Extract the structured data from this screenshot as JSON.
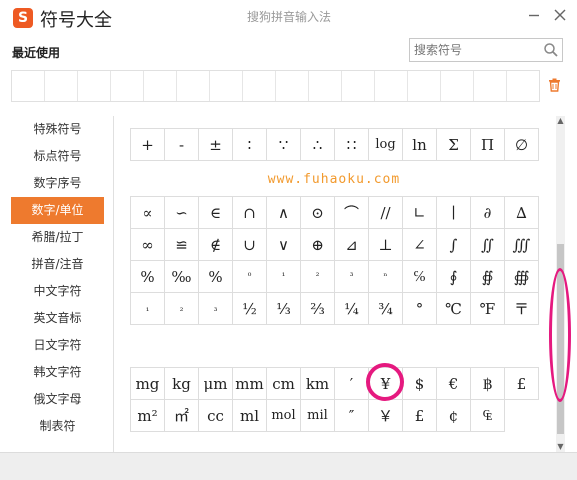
{
  "app": {
    "logo_glyph": "S",
    "title": "符号大全",
    "subtitle": "搜狗拼音输入法",
    "accent_color": "#ee7a2e"
  },
  "window_controls": {
    "minimize_glyph": "─",
    "close_glyph": "✕"
  },
  "recent": {
    "label": "最近使用",
    "slot_count": 16
  },
  "search": {
    "placeholder": "搜索符号",
    "value": "",
    "icon": "search-icon"
  },
  "trash": {
    "icon": "trash-icon"
  },
  "sidebar": {
    "selected": "数字/单位",
    "items": [
      "特殊符号",
      "标点符号",
      "数字序号",
      "数字/单位",
      "希腊/拉丁",
      "拼音/注音",
      "中文字符",
      "英文音标",
      "日文字符",
      "韩文字符",
      "俄文字母",
      "制表符"
    ]
  },
  "watermark": "www.fuhaoku.com",
  "symbols": {
    "grid1": [
      "+",
      "-",
      "±",
      "∶",
      "∵",
      "∴",
      "∷",
      "log",
      "ln",
      "Σ",
      "Π",
      "∅"
    ],
    "grid2": [
      "∝",
      "∽",
      "∈",
      "∩",
      "∧",
      "⊙",
      "⌒",
      "//",
      "∟",
      "∣",
      "∂",
      "∆",
      "∞",
      "≌",
      "∉",
      "∪",
      "∨",
      "⊕",
      "⊿",
      "⊥",
      "∠",
      "∫",
      "∬",
      "∭",
      "%",
      "‰",
      "%",
      "⁰",
      "¹",
      "²",
      "³",
      "ⁿ",
      "℅",
      "∮",
      "∯",
      "∰",
      "₁",
      "₂",
      "₃",
      "½",
      "⅓",
      "⅔",
      "¼",
      "¾",
      "°",
      "℃",
      "℉",
      "〒"
    ],
    "grid3": [
      "mg",
      "kg",
      "μm",
      "mm",
      "cm",
      "km",
      "′",
      "¥",
      "$",
      "€",
      "฿",
      "£",
      "m²",
      "㎡",
      "cc",
      "ml",
      "mol",
      "mil",
      "″",
      "￥",
      "£",
      "¢",
      "₠"
    ]
  },
  "annotations": {
    "highlight_color": "#e5197f",
    "highlighted_symbol": "¥"
  }
}
